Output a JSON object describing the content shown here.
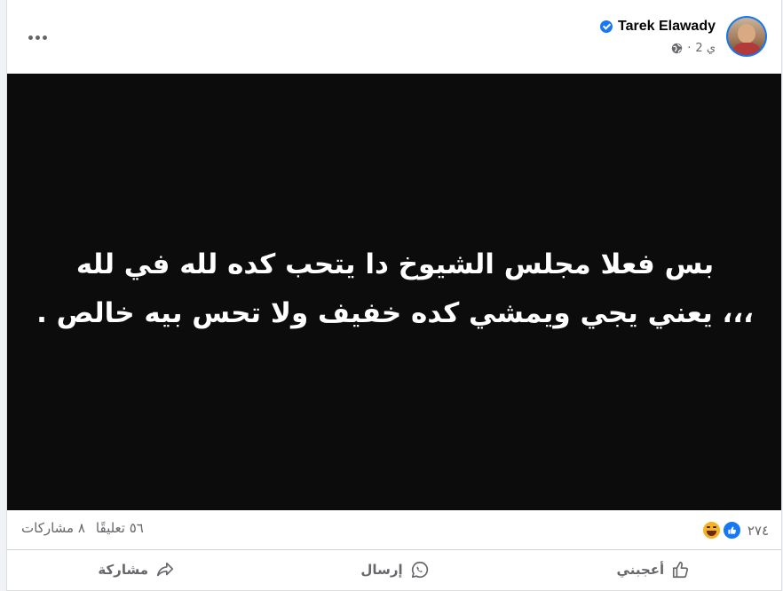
{
  "post": {
    "author": "Tarek Elawady",
    "timestamp": "2 ي",
    "separator": "·",
    "audience_icon": "globe-icon",
    "more_icon": "more-options-icon",
    "verified_icon": "verified-badge-icon",
    "image_text_line1": "بس فعلا مجلس الشيوخ دا يتحب كده لله في لله",
    "image_text_line2": "،،، يعني يجي ويمشي كده خفيف ولا تحس بيه خالص ."
  },
  "stats": {
    "reaction_icons": [
      "like-reaction-icon",
      "haha-reaction-icon"
    ],
    "reaction_count": "٢٧٤",
    "comments": "٥٦ تعليقًا",
    "shares": "٨ مشاركات"
  },
  "actions": {
    "like": "أعجبني",
    "send": "إرسال",
    "share": "مشاركة"
  },
  "colors": {
    "accent": "#1877f2",
    "secondary_text": "#65676b",
    "image_background": "#0c0c0c"
  }
}
